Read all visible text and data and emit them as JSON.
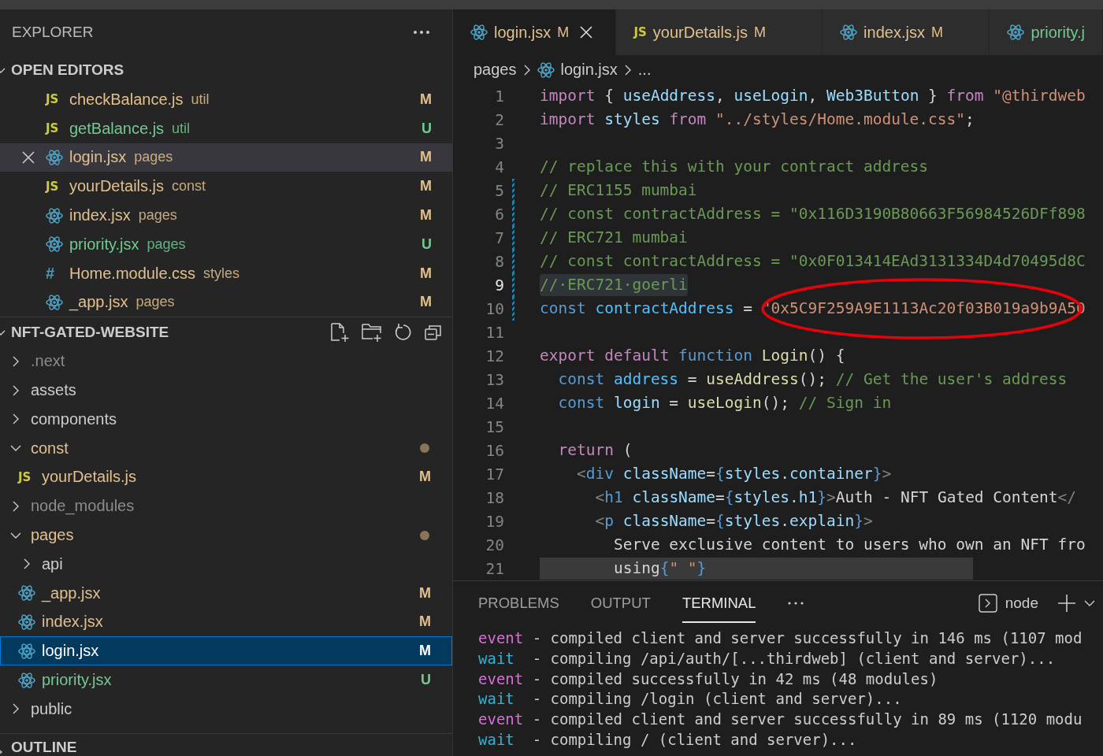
{
  "sidebar": {
    "title": "EXPLORER",
    "open_editors": {
      "title": "OPEN EDITORS",
      "expanded": true,
      "items": [
        {
          "name": "checkBalance.js",
          "folder": "util",
          "kind": "js",
          "icon_text": "JS",
          "color": "#e2c08d",
          "status": "M",
          "selected": false
        },
        {
          "name": "getBalance.js",
          "folder": "util",
          "kind": "js",
          "icon_text": "JS",
          "color": "#73c991",
          "status": "U",
          "selected": false
        },
        {
          "name": "login.jsx",
          "folder": "pages",
          "kind": "react",
          "color": "#e2c08d",
          "status": "M",
          "selected": true
        },
        {
          "name": "yourDetails.js",
          "folder": "const",
          "kind": "js",
          "icon_text": "JS",
          "color": "#e2c08d",
          "status": "M",
          "selected": false
        },
        {
          "name": "index.jsx",
          "folder": "pages",
          "kind": "react",
          "color": "#e2c08d",
          "status": "M",
          "selected": false
        },
        {
          "name": "priority.jsx",
          "folder": "pages",
          "kind": "react",
          "color": "#73c991",
          "status": "U",
          "selected": false
        },
        {
          "name": "Home.module.css",
          "folder": "styles",
          "kind": "css",
          "icon_text": "#",
          "color": "#e2c08d",
          "status": "M",
          "selected": false
        },
        {
          "name": "_app.jsx",
          "folder": "pages",
          "kind": "react",
          "color": "#e2c08d",
          "status": "M",
          "selected": false
        }
      ]
    },
    "project": {
      "title": "NFT-GATED-WEBSITE",
      "expanded": true,
      "tree": [
        {
          "name": ".next",
          "kind": "folder",
          "expanded": false,
          "modified": false,
          "color": "#8c8c8c",
          "selected": false
        },
        {
          "name": "assets",
          "kind": "folder",
          "expanded": false,
          "modified": false,
          "color": "#cccccc",
          "selected": false
        },
        {
          "name": "components",
          "kind": "folder",
          "expanded": false,
          "modified": false,
          "color": "#cccccc",
          "selected": false
        },
        {
          "name": "const",
          "kind": "folder",
          "expanded": true,
          "modified": true,
          "color": "#e2c08d",
          "selected": false,
          "children": [
            {
              "name": "yourDetails.js",
              "kind": "js",
              "icon_text": "JS",
              "color": "#e2c08d",
              "status": "M",
              "selected": false
            }
          ]
        },
        {
          "name": "node_modules",
          "kind": "folder",
          "expanded": false,
          "modified": false,
          "color": "#8c8c8c",
          "selected": false
        },
        {
          "name": "pages",
          "kind": "folder",
          "expanded": true,
          "modified": true,
          "color": "#e2c08d",
          "selected": false,
          "children": [
            {
              "name": "api",
              "kind": "folder",
              "expanded": false,
              "modified": false,
              "color": "#cccccc",
              "selected": false
            },
            {
              "name": "_app.jsx",
              "kind": "react",
              "color": "#e2c08d",
              "status": "M",
              "selected": false
            },
            {
              "name": "index.jsx",
              "kind": "react",
              "color": "#e2c08d",
              "status": "M",
              "selected": false
            },
            {
              "name": "login.jsx",
              "kind": "react",
              "color": "#ffffff",
              "status": "M",
              "selected": true
            },
            {
              "name": "priority.jsx",
              "kind": "react",
              "color": "#73c991",
              "status": "U",
              "selected": false
            }
          ]
        },
        {
          "name": "public",
          "kind": "folder",
          "expanded": false,
          "modified": false,
          "color": "#cccccc",
          "selected": false
        }
      ]
    },
    "outline": {
      "title": "OUTLINE",
      "expanded": false
    }
  },
  "editor": {
    "tabs": [
      {
        "name": "login.jsx",
        "status": "M",
        "kind": "react",
        "color": "#e2c08d",
        "selected": true
      },
      {
        "name": "yourDetails.js",
        "status": "M",
        "kind": "js",
        "icon_text": "JS",
        "color": "#e2c08d",
        "selected": false
      },
      {
        "name": "index.jsx",
        "status": "M",
        "kind": "react",
        "color": "#e2c08d",
        "selected": false
      },
      {
        "name": "priority.j",
        "kind": "react",
        "color": "#73c991",
        "selected": false
      }
    ],
    "breadcrumb": [
      {
        "label": "pages"
      },
      {
        "label": "login.jsx",
        "kind": "react"
      },
      {
        "label": "..."
      }
    ],
    "lines": [
      {
        "number": "1",
        "active": false,
        "modified": false,
        "highlighted": false,
        "tokens": [
          {
            "kind": "keyword",
            "s": "import "
          },
          {
            "kind": "plain",
            "s": "{ "
          },
          {
            "kind": "variable",
            "s": "useAddress"
          },
          {
            "kind": "plain",
            "s": ", "
          },
          {
            "kind": "variable",
            "s": "useLogin"
          },
          {
            "kind": "plain",
            "s": ", "
          },
          {
            "kind": "variable",
            "s": "Web3Button"
          },
          {
            "kind": "plain",
            "s": " } "
          },
          {
            "kind": "keyword",
            "s": "from "
          },
          {
            "kind": "string",
            "s": "\"@thirdweb"
          }
        ]
      },
      {
        "number": "2",
        "active": false,
        "modified": false,
        "highlighted": false,
        "tokens": [
          {
            "kind": "keyword",
            "s": "import "
          },
          {
            "kind": "variable",
            "s": "styles "
          },
          {
            "kind": "keyword",
            "s": "from "
          },
          {
            "kind": "string",
            "s": "\"../styles/Home.module.css\""
          },
          {
            "kind": "plain",
            "s": ";"
          }
        ]
      },
      {
        "number": "3",
        "active": false,
        "modified": false,
        "highlighted": false
      },
      {
        "number": "4",
        "active": false,
        "modified": false,
        "highlighted": false,
        "tokens": [
          {
            "kind": "comment",
            "s": "// replace this with your contract address"
          }
        ]
      },
      {
        "number": "5",
        "active": false,
        "modified": true,
        "highlighted": false,
        "tokens": [
          {
            "kind": "comment",
            "s": "// ERC1155 mumbai"
          }
        ]
      },
      {
        "number": "6",
        "active": false,
        "modified": true,
        "highlighted": false,
        "tokens": [
          {
            "kind": "comment",
            "s": "// const contractAddress = \"0x116D3190B80663F56984526DFf898"
          }
        ]
      },
      {
        "number": "7",
        "active": false,
        "modified": true,
        "highlighted": false,
        "tokens": [
          {
            "kind": "comment",
            "s": "// ERC721 mumbai"
          }
        ]
      },
      {
        "number": "8",
        "active": false,
        "modified": true,
        "highlighted": false,
        "tokens": [
          {
            "kind": "comment",
            "s": "// const contractAddress = \"0x0F013414EAd3131334D4d70495d8C"
          }
        ]
      },
      {
        "number": "9",
        "active": true,
        "modified": true,
        "highlighted": false,
        "tokens": [
          {
            "kind": "comment",
            "s": "//·ERC721·goerli"
          }
        ]
      },
      {
        "number": "10",
        "active": false,
        "modified": true,
        "highlighted": false,
        "tokens": [
          {
            "kind": "storage",
            "s": "const "
          },
          {
            "kind": "constant",
            "s": "contractAddress"
          },
          {
            "kind": "plain",
            "s": " = "
          },
          {
            "kind": "string",
            "s": "\"0x5C9F259A9E1113Ac20f03B019a9b9A50"
          }
        ]
      },
      {
        "number": "11",
        "active": false,
        "modified": false,
        "highlighted": false
      },
      {
        "number": "12",
        "active": false,
        "modified": false,
        "highlighted": false,
        "tokens": [
          {
            "kind": "keyword",
            "s": "export "
          },
          {
            "kind": "keyword",
            "s": "default "
          },
          {
            "kind": "storage",
            "s": "function "
          },
          {
            "kind": "function",
            "s": "Login"
          },
          {
            "kind": "plain",
            "s": "() {"
          }
        ]
      },
      {
        "number": "13",
        "active": false,
        "modified": false,
        "highlighted": false,
        "tokens": [
          {
            "kind": "storage",
            "s": "  const "
          },
          {
            "kind": "constant",
            "s": "address"
          },
          {
            "kind": "plain",
            "s": " = "
          },
          {
            "kind": "function",
            "s": "useAddress"
          },
          {
            "kind": "plain",
            "s": "(); "
          },
          {
            "kind": "comment",
            "s": "// Get the user's address"
          }
        ]
      },
      {
        "number": "14",
        "active": false,
        "modified": false,
        "highlighted": false,
        "tokens": [
          {
            "kind": "storage",
            "s": "  const "
          },
          {
            "kind": "variable",
            "s": "login"
          },
          {
            "kind": "plain",
            "s": " = "
          },
          {
            "kind": "function",
            "s": "useLogin"
          },
          {
            "kind": "plain",
            "s": "(); "
          },
          {
            "kind": "comment",
            "s": "// Sign in"
          }
        ]
      },
      {
        "number": "15",
        "active": false,
        "modified": false,
        "highlighted": false
      },
      {
        "number": "16",
        "active": false,
        "modified": false,
        "highlighted": false,
        "tokens": [
          {
            "kind": "keyword",
            "s": "  return"
          },
          {
            "kind": "plain",
            "s": " ("
          }
        ]
      },
      {
        "number": "17",
        "active": false,
        "modified": false,
        "highlighted": false,
        "tokens": [
          {
            "kind": "tag",
            "s": "    <"
          },
          {
            "kind": "storage",
            "s": "div "
          },
          {
            "kind": "variable",
            "s": "className"
          },
          {
            "kind": "plain",
            "s": "="
          },
          {
            "kind": "brace",
            "s": "{"
          },
          {
            "kind": "variable",
            "s": "styles.container"
          },
          {
            "kind": "brace",
            "s": "}"
          },
          {
            "kind": "tag",
            "s": ">"
          }
        ]
      },
      {
        "number": "18",
        "active": false,
        "modified": false,
        "highlighted": false,
        "tokens": [
          {
            "kind": "tag",
            "s": "      <"
          },
          {
            "kind": "storage",
            "s": "h1 "
          },
          {
            "kind": "variable",
            "s": "className"
          },
          {
            "kind": "plain",
            "s": "="
          },
          {
            "kind": "brace",
            "s": "{"
          },
          {
            "kind": "variable",
            "s": "styles.h1"
          },
          {
            "kind": "brace",
            "s": "}"
          },
          {
            "kind": "tag",
            "s": ">"
          },
          {
            "kind": "plain",
            "s": "Auth - NFT Gated Content"
          },
          {
            "kind": "tag",
            "s": "</"
          }
        ]
      },
      {
        "number": "19",
        "active": false,
        "modified": false,
        "highlighted": false,
        "tokens": [
          {
            "kind": "tag",
            "s": "      <"
          },
          {
            "kind": "storage",
            "s": "p "
          },
          {
            "kind": "variable",
            "s": "className"
          },
          {
            "kind": "plain",
            "s": "="
          },
          {
            "kind": "brace",
            "s": "{"
          },
          {
            "kind": "variable",
            "s": "styles.explain"
          },
          {
            "kind": "brace",
            "s": "}"
          },
          {
            "kind": "tag",
            "s": ">"
          }
        ]
      },
      {
        "number": "20",
        "active": false,
        "modified": false,
        "highlighted": false,
        "tokens": [
          {
            "kind": "plain",
            "s": "        Serve exclusive content to users who own an NFT fro"
          }
        ]
      },
      {
        "number": "21",
        "active": false,
        "modified": false,
        "highlighted": true,
        "tokens": [
          {
            "kind": "plain",
            "s": "        using"
          },
          {
            "kind": "brace",
            "s": "{"
          },
          {
            "kind": "string",
            "s": "\" \""
          },
          {
            "kind": "brace",
            "s": "}"
          }
        ]
      }
    ]
  },
  "panel": {
    "tabs": [
      {
        "label": "PROBLEMS",
        "selected": false
      },
      {
        "label": "OUTPUT",
        "selected": false
      },
      {
        "label": "TERMINAL",
        "selected": true
      }
    ],
    "terminal_name": "node",
    "lines": [
      {
        "kind": "event",
        "label": "event",
        "text": " - compiled client and server successfully in 146 ms (1107 mod"
      },
      {
        "kind": "wait",
        "label": "wait",
        "text": " - compiling /api/auth/[...thirdweb] (client and server)..."
      },
      {
        "kind": "event",
        "label": "event",
        "text": " - compiled successfully in 42 ms (48 modules)"
      },
      {
        "kind": "wait",
        "label": "wait",
        "text": " - compiling /login (client and server)..."
      },
      {
        "kind": "event",
        "label": "event",
        "text": " - compiled client and server successfully in 89 ms (1120 modu"
      },
      {
        "kind": "wait",
        "label": "wait",
        "text": " - compiling / (client and server)..."
      }
    ]
  }
}
